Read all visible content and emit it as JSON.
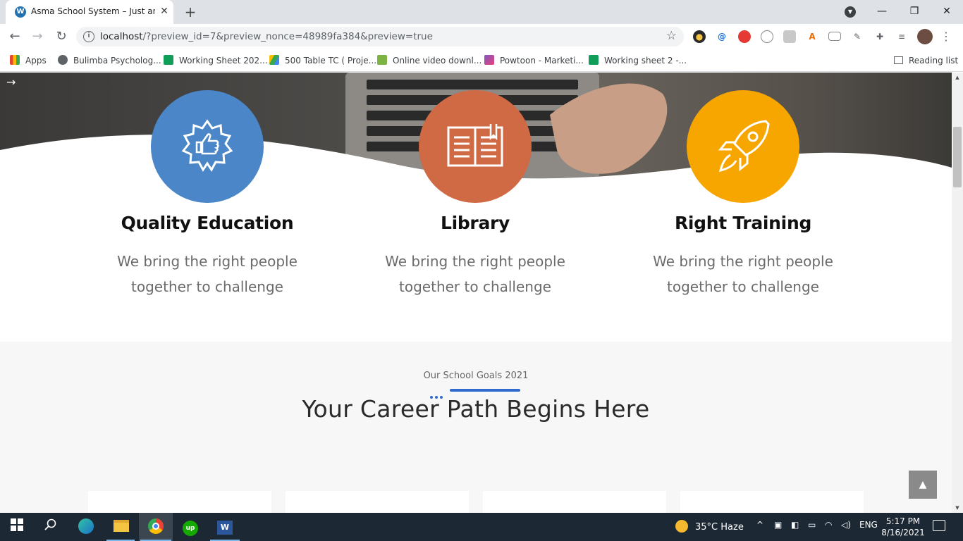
{
  "browser": {
    "tab_title": "Asma School System – Just anot",
    "url_host": "localhost",
    "url_rest": "/?preview_id=7&preview_nonce=48989fa384&preview=true",
    "bookmarks": [
      {
        "label": "Apps",
        "icon": "apps-grid-icon"
      },
      {
        "label": "Bulimba Psycholog...",
        "icon": "globe-icon"
      },
      {
        "label": "Working Sheet 202...",
        "icon": "sheets-icon"
      },
      {
        "label": "500 Table TC ( Proje...",
        "icon": "drive-icon"
      },
      {
        "label": "Online video downl...",
        "icon": "download-icon"
      },
      {
        "label": "Powtoon - Marketi...",
        "icon": "powtoon-icon"
      },
      {
        "label": "Working sheet 2 -...",
        "icon": "sheets-icon"
      }
    ],
    "reading_list": "Reading list"
  },
  "features": [
    {
      "title": "Quality Education",
      "text_line1": "We bring the right people",
      "text_line2": "together to challenge",
      "color": "#4a86c8",
      "icon": "thumbs-up-badge-icon"
    },
    {
      "title": "Library",
      "text_line1": "We bring the right people",
      "text_line2": "together to challenge",
      "color": "#cf6a45",
      "icon": "open-book-icon"
    },
    {
      "title": "Right Training",
      "text_line1": "We bring the right people",
      "text_line2": "together to challenge",
      "color": "#f7a600",
      "icon": "rocket-icon"
    }
  ],
  "goals": {
    "kicker": "Our School Goals 2021",
    "heading": "Your Career Path Begins Here",
    "accent_color": "#2f6bcf"
  },
  "taskbar": {
    "weather": "35°C  Haze",
    "language": "ENG",
    "time": "5:17 PM",
    "date": "8/16/2021"
  }
}
